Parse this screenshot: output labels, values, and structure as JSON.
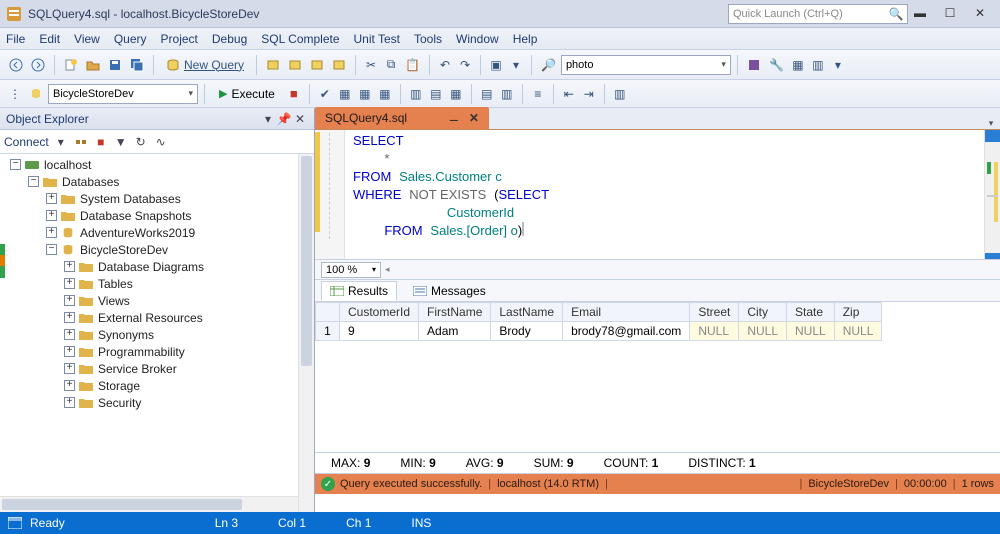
{
  "window": {
    "title": "SQLQuery4.sql - localhost.BicycleStoreDev"
  },
  "quicklaunch": {
    "placeholder": "Quick Launch (Ctrl+Q)"
  },
  "menu": {
    "file": "File",
    "edit": "Edit",
    "view": "View",
    "query": "Query",
    "project": "Project",
    "debug": "Debug",
    "sqlcomplete": "SQL Complete",
    "unittest": "Unit Test",
    "tools": "Tools",
    "window": "Window",
    "help": "Help"
  },
  "toolbar1": {
    "newquery": "New Query",
    "photo": "photo"
  },
  "toolbar2": {
    "db": "BicycleStoreDev",
    "execute": "Execute"
  },
  "objectExplorer": {
    "title": "Object Explorer",
    "connect": "Connect",
    "root": "localhost",
    "databases": "Databases",
    "sysdb": "System Databases",
    "snapshots": "Database Snapshots",
    "aw": "AdventureWorks2019",
    "bsd": "BicycleStoreDev",
    "children": {
      "diagrams": "Database Diagrams",
      "tables": "Tables",
      "views": "Views",
      "extres": "External Resources",
      "synonyms": "Synonyms",
      "prog": "Programmability",
      "sbroker": "Service Broker",
      "storage": "Storage",
      "security": "Security"
    }
  },
  "tab": {
    "name": "SQLQuery4.sql"
  },
  "sql": {
    "select": "SELECT",
    "star": "*",
    "from1": "FROM",
    "tbl1": "Sales.Customer c",
    "where": "WHERE",
    "notexists": "NOT EXISTS",
    "selectinner": "SELECT",
    "col": "CustomerId",
    "from2": "FROM",
    "tbl2": "Sales.[Order] o",
    "paren": ")"
  },
  "zoom": "100 %",
  "resultsTabs": {
    "results": "Results",
    "messages": "Messages"
  },
  "grid": {
    "headers": [
      "",
      "CustomerId",
      "FirstName",
      "LastName",
      "Email",
      "Street",
      "City",
      "State",
      "Zip"
    ],
    "row": {
      "n": "1",
      "id": "9",
      "fn": "Adam",
      "ln": "Brody",
      "email": "brody78@gmail.com",
      "street": "NULL",
      "city": "NULL",
      "state": "NULL",
      "zip": "NULL"
    }
  },
  "agg": {
    "max": "MAX:",
    "maxv": "9",
    "min": "MIN:",
    "minv": "9",
    "avg": "AVG:",
    "avgv": "9",
    "sum": "SUM:",
    "sumv": "9",
    "count": "COUNT:",
    "countv": "1",
    "distinct": "DISTINCT:",
    "distinctv": "1"
  },
  "status2": {
    "msg": "Query executed successfully.",
    "server": "localhost (14.0 RTM)",
    "db": "BicycleStoreDev",
    "time": "00:00:00",
    "rows": "1 rows"
  },
  "bottom": {
    "ready": "Ready",
    "ln": "Ln 3",
    "col": "Col 1",
    "ch": "Ch 1",
    "ins": "INS"
  }
}
